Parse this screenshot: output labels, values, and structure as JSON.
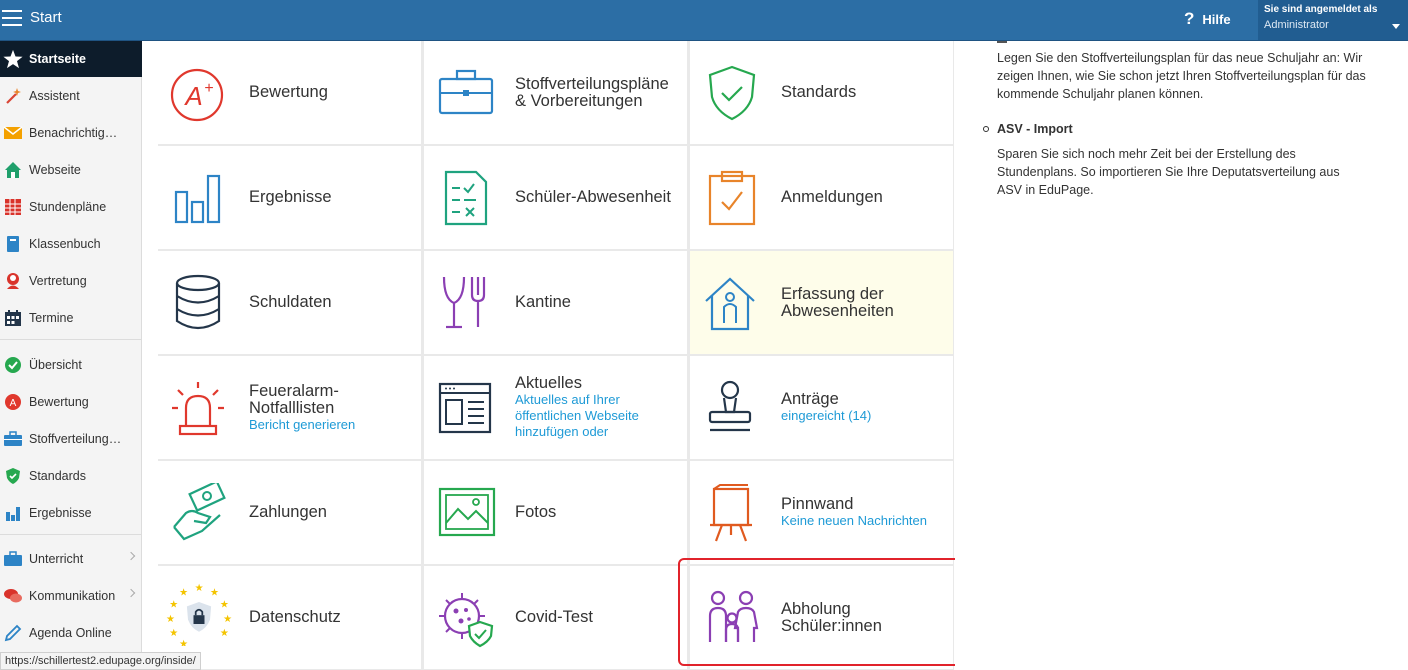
{
  "header": {
    "app_title": "Start",
    "help_label": "Hilfe",
    "login_label": "Sie sind angemeldet als",
    "login_user": "Administrator"
  },
  "sidebar": {
    "items": [
      {
        "label": "Startseite",
        "icon": "star-icon"
      },
      {
        "label": "Assistent",
        "icon": "magic-wand-icon"
      },
      {
        "label": "Benachrichtigungen",
        "icon": "envelope-icon"
      },
      {
        "label": "Webseite",
        "icon": "house-icon"
      },
      {
        "label": "Stundenpläne",
        "icon": "timetable-icon"
      },
      {
        "label": "Klassenbuch",
        "icon": "book-icon"
      },
      {
        "label": "Vertretung",
        "icon": "substitute-icon"
      },
      {
        "label": "Termine",
        "icon": "calendar-icon"
      },
      {
        "label": "Übersicht",
        "icon": "check-circle-icon"
      },
      {
        "label": "Bewertung",
        "icon": "grade-icon"
      },
      {
        "label": "Stoffverteilungspläne",
        "icon": "briefcase-icon"
      },
      {
        "label": "Standards",
        "icon": "shield-icon"
      },
      {
        "label": "Ergebnisse",
        "icon": "bar-chart-icon"
      },
      {
        "label": "Unterricht",
        "icon": "briefcase-icon"
      },
      {
        "label": "Kommunikation",
        "icon": "chat-icon"
      },
      {
        "label": "Agenda Online",
        "icon": "pen-icon"
      }
    ]
  },
  "tiles": [
    {
      "name": "Bewertung",
      "sub": "",
      "icon": "grade-a-plus-icon"
    },
    {
      "name": "Stoffverteilungspläne & Vorbereitungen",
      "sub": "",
      "icon": "briefcase-icon"
    },
    {
      "name": "Standards",
      "sub": "",
      "icon": "shield-check-icon"
    },
    {
      "name": "Ergebnisse",
      "sub": "",
      "icon": "bar-chart-icon"
    },
    {
      "name": "Schüler-Abwesenheit",
      "sub": "",
      "icon": "checklist-icon"
    },
    {
      "name": "Anmeldungen",
      "sub": "",
      "icon": "clipboard-check-icon"
    },
    {
      "name": "Schuldaten",
      "sub": "",
      "icon": "database-icon"
    },
    {
      "name": "Kantine",
      "sub": "",
      "icon": "cutlery-icon"
    },
    {
      "name": "Erfassung der Abwesenheiten",
      "sub": "",
      "icon": "house-person-icon"
    },
    {
      "name": "Feueralarm-Notfalllisten",
      "sub": "Bericht generieren",
      "icon": "alarm-siren-icon"
    },
    {
      "name": "Aktuelles",
      "sub": "Aktuelles auf Ihrer öffentlichen Webseite hinzufügen oder",
      "icon": "newspaper-icon"
    },
    {
      "name": "Anträge",
      "sub": "eingereicht (14)",
      "icon": "stamp-icon"
    },
    {
      "name": "Zahlungen",
      "sub": "",
      "icon": "money-hand-icon"
    },
    {
      "name": "Fotos",
      "sub": "",
      "icon": "photo-icon"
    },
    {
      "name": "Pinnwand",
      "sub": "Keine neuen Nachrichten",
      "icon": "easel-board-icon"
    },
    {
      "name": "Datenschutz",
      "sub": "",
      "icon": "eu-lock-icon"
    },
    {
      "name": "Covid-Test",
      "sub": "",
      "icon": "virus-shield-icon"
    },
    {
      "name": "Abholung Schüler:innen",
      "sub": "",
      "icon": "family-icon"
    }
  ],
  "right_panel": {
    "para1": "Legen Sie den Stoffverteilungsplan für das neue Schuljahr an: Wir zeigen Ihnen, wie Sie schon jetzt Ihren Stoffverteilungsplan für das kommende Schuljahr planen können.",
    "bullet_title": "ASV - Import",
    "para2": "Sparen Sie sich noch mehr Zeit bei der Erstellung des Stundenplans. So importieren Sie Ihre Deputatsverteilung aus ASV in EduPage."
  },
  "status_url": "https://schillertest2.edupage.org/inside/",
  "colors": {
    "topbar": "#2c6ea5",
    "link": "#1e9ad6",
    "highlight_frame": "#e1232b"
  }
}
